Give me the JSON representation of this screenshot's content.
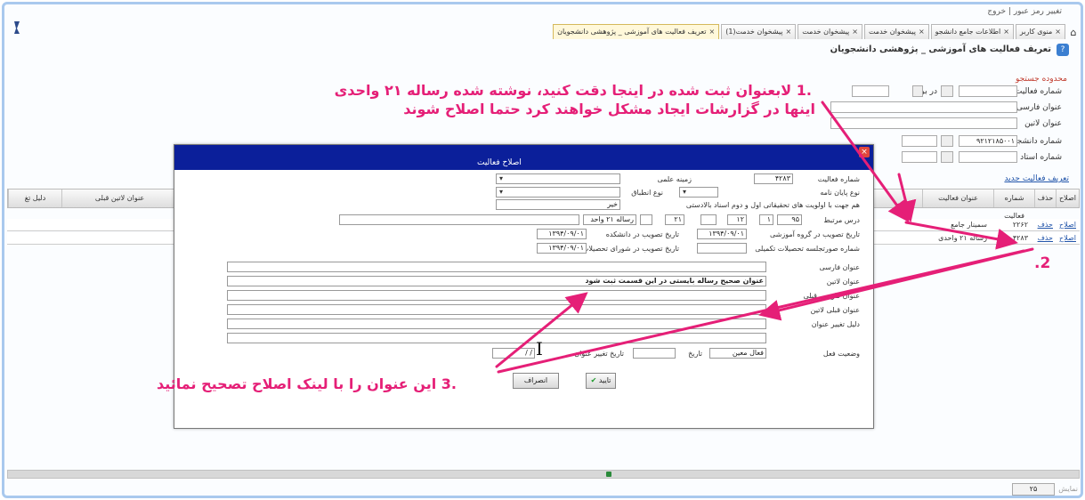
{
  "header": {
    "top_links": "تغییر رمز عبور | خروج",
    "status_text": "",
    "home_icon": "home-icon"
  },
  "tabs": [
    {
      "label": "منوی کاربر",
      "active": false
    },
    {
      "label": "اطلاعات جامع دانشجو",
      "active": false
    },
    {
      "label": "پیشخوان خدمت",
      "active": false
    },
    {
      "label": "پیشخوان خدمت",
      "active": false
    },
    {
      "label": "پیشخوان خدمت(1)",
      "active": false
    },
    {
      "label": "تعریف فعالیت های آموزشی _ پژوهشی دانشجویان",
      "active": true
    }
  ],
  "page_title": "تعریف فعالیت های آموزشی _ پژوهشی دانشجویان",
  "filter_form": {
    "caption": "محدوده جستجو",
    "labels": {
      "activity_no": "شماره فعالیت",
      "persian_title": "عنوان فارسی",
      "latin_title": "عنوان لاتین",
      "student_no": "شماره دانشجو",
      "professor_no": "شماره استاد",
      "in_list": "در برابه"
    },
    "student_no_value": "۹۲۱۲۱۸۵۰۰۱"
  },
  "new_activity_link": "تعریف فعالیت جدید",
  "grid": {
    "columns": [
      "اصلاح",
      "حذف",
      "شماره فعالیت",
      "عنوان فعالیت",
      "عنوان لاتین قبلی",
      "دلیل تغ"
    ],
    "rows": [
      {
        "edit": "اصلاح",
        "delete": "حذف",
        "number": "۲۲۶۲",
        "title": "سمینار جامع"
      },
      {
        "edit": "اصلاح",
        "delete": "حذف",
        "number": "۴۲۸۳",
        "title": "رساله ۲۱ واحدی"
      }
    ]
  },
  "dialog": {
    "title": "اصلاح فعالیت",
    "close_label": "×",
    "labels": {
      "activity_no": "شماره فعالیت",
      "field": "زمینه علمی",
      "thesis_type": "نوع پایان نامه",
      "apply_type": "نوع انطباق",
      "alignment": "هم جهت با اولویت های تحقیقاتی اول و دوم اسناد بالادستی",
      "course": "درس مرتبط",
      "group_date": "تاریخ تصویب در گروه آموزشی",
      "faculty_date": "تاریخ تصویب در دانشکده",
      "council_no": "شماره صورتجلسه تحصیلات تکمیلی",
      "council_date": "تاریخ تصویب در شورای تحصیلات تکمیلی",
      "persian_title": "عنوان فارسی",
      "latin_title": "عنوان لاتین",
      "prev_persian_title": "عنوان فارسی قبلی",
      "prev_latin_title": "عنوان قبلی لاتین",
      "change_reason": "دلیل تغییر عنوان",
      "status": "وضعیت فعل",
      "date": "تاریخ",
      "title_change_date": "تاریخ تغییر عنوان"
    },
    "values": {
      "activity_no": "۴۲۸۳",
      "alignment": "خیر",
      "course_code": "۲۱",
      "course_name": "رساله ۲۱ واحد",
      "course_unit": "۱۲",
      "course_group": "۱",
      "course_sel": "۹۵",
      "group_date": "۱۳۹۴/۰۹/۰۱",
      "faculty_date": "۱۳۹۴/۰۹/۰۱",
      "council_date": "۱۳۹۴/۰۹/۰۱",
      "persian_title": "عنوان صحیح رساله بایستی در این قسمت ثبت شود",
      "status": "فعال معین",
      "title_change_date": "/ / "
    },
    "buttons": {
      "ok": "تایید",
      "cancel": "انصراف"
    }
  },
  "annotations": {
    "note1_line1": ".1 لابعنوان ثبت شده در اینجا دقت کنید، نوشته شده رساله ۲۱ واحدی",
    "note1_line2": "اینها در گزارشات ایجاد مشکل خواهند کرد حتما اصلاح شوند",
    "note2": ".2",
    "note3": ".3 این عنوان را با لینک اصلاح تصحیح نمائید",
    "color": "#e51f77"
  },
  "pager": {
    "select_value": "۲۵",
    "label": "نمایش"
  }
}
